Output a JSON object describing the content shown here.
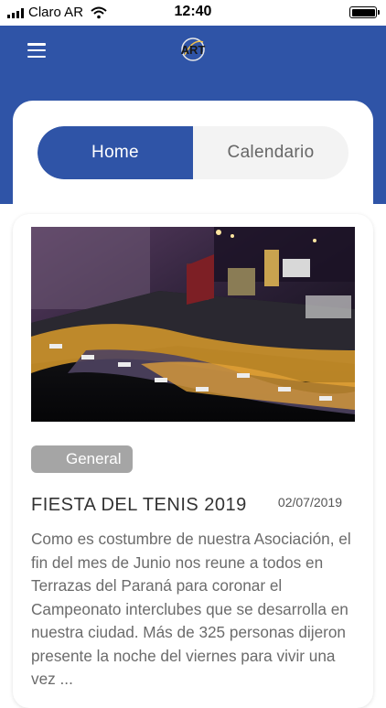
{
  "status": {
    "carrier": "Claro AR",
    "time": "12:40"
  },
  "header": {
    "logo_text": "ART",
    "colors": {
      "brand": "#2f54a7",
      "background": "#ffffff"
    }
  },
  "tabs": [
    {
      "label": "Home",
      "active": true
    },
    {
      "label": "Calendario",
      "active": false
    }
  ],
  "news": [
    {
      "category": "General",
      "title": "FIESTA DEL TENIS 2019",
      "date": "02/07/2019",
      "excerpt": "Como es costumbre de nuestra Asociación, el fin del mes de Junio nos reune a todos en Terrazas del Paraná para coronar el Campeonato interclubes que se desarrolla en nuestra ciudad. Más de 325 personas dijeron presente la noche del viernes para vivir una vez ..."
    }
  ]
}
